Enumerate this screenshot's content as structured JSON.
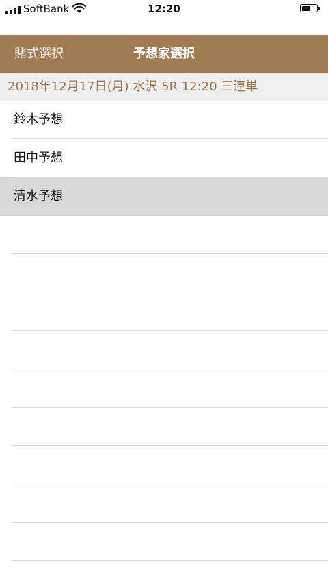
{
  "status_bar": {
    "carrier": "SoftBank",
    "time": "12:20",
    "icons": [
      "signal-icon",
      "wifi-icon",
      "battery-icon"
    ],
    "battery_level": 0.6
  },
  "nav_bar": {
    "back_label": "賭式選択",
    "title": "予想家選択",
    "color": "#a07c55"
  },
  "race_header": {
    "text": "2018年12月17日(月) 水沢 5R 12:20 三連単",
    "color": "#9b7550"
  },
  "forecasters": [
    {
      "name": "鈴木予想",
      "selected": false
    },
    {
      "name": "田中予想",
      "selected": false
    },
    {
      "name": "清水予想",
      "selected": true
    }
  ],
  "selected_row_color": "#d8d8d8"
}
